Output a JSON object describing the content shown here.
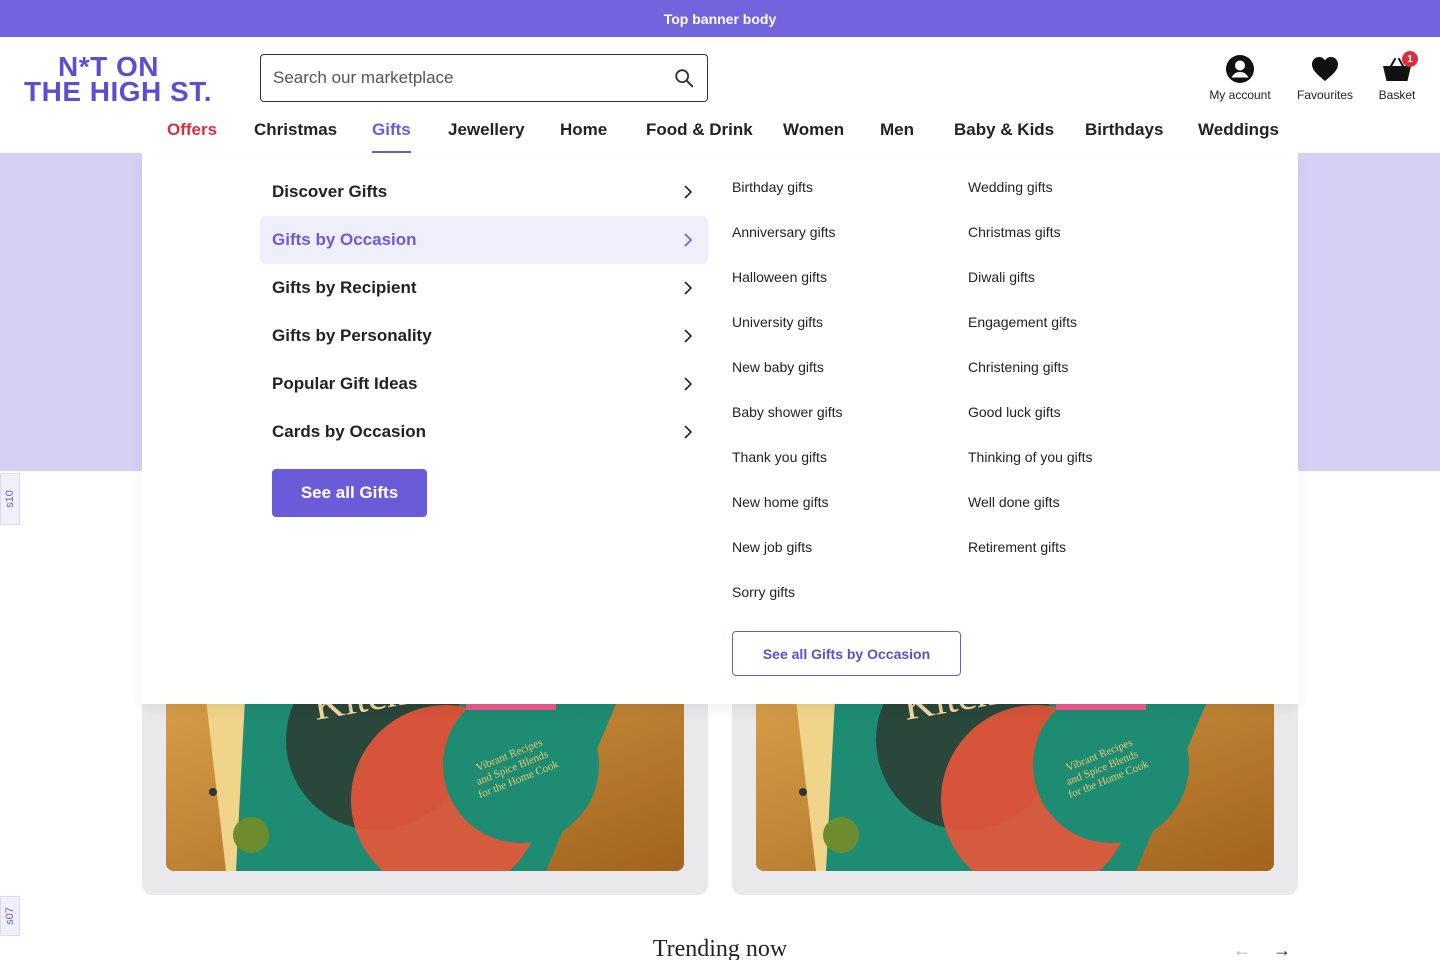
{
  "banner": {
    "text": "Top banner body"
  },
  "logo": {
    "line1": "N*T ON",
    "line2": "THE HIGH ST."
  },
  "search": {
    "placeholder": "Search our marketplace"
  },
  "utility": {
    "account_label": "My account",
    "favourites_label": "Favourites",
    "basket_label": "Basket",
    "basket_count": "1"
  },
  "nav": {
    "items": [
      {
        "label": "Offers"
      },
      {
        "label": "Christmas"
      },
      {
        "label": "Gifts"
      },
      {
        "label": "Jewellery"
      },
      {
        "label": "Home"
      },
      {
        "label": "Food & Drink"
      },
      {
        "label": "Women"
      },
      {
        "label": "Men"
      },
      {
        "label": "Baby & Kids"
      },
      {
        "label": "Birthdays"
      },
      {
        "label": "Weddings"
      }
    ],
    "active": "Gifts"
  },
  "mega_menu": {
    "categories": [
      {
        "label": "Discover Gifts"
      },
      {
        "label": "Gifts by Occasion"
      },
      {
        "label": "Gifts by Recipient"
      },
      {
        "label": "Gifts by Personality"
      },
      {
        "label": "Popular Gift Ideas"
      },
      {
        "label": "Cards by Occasion"
      }
    ],
    "active_category": "Gifts by Occasion",
    "see_all_label": "See all Gifts",
    "column1": [
      "Birthday gifts",
      "Anniversary gifts",
      "Halloween gifts",
      "University gifts",
      "New baby gifts",
      "Baby shower gifts",
      "Thank you gifts",
      "New home gifts",
      "New job gifts",
      "Sorry gifts"
    ],
    "column2": [
      "Wedding gifts",
      "Christmas gifts",
      "Diwali gifts",
      "Engagement gifts",
      "Christening gifts",
      "Good luck gifts",
      "Thinking of you gifts",
      "Well done gifts",
      "Retirement gifts"
    ],
    "see_all_occasion_label": "See all Gifts by Occasion"
  },
  "side_tabs": {
    "tab1": "s10",
    "tab2": "s07"
  },
  "book": {
    "title_fragment": "Kitche",
    "tagline": [
      "Vibrant Recipes",
      "and Spice Blends",
      "for the Home Cook"
    ]
  },
  "trending": {
    "title": "Trending now"
  },
  "colors": {
    "brand": "#6a5cd8",
    "banner": "#7164dc",
    "offer": "#d9303f",
    "hero": "#d5d1f4"
  }
}
